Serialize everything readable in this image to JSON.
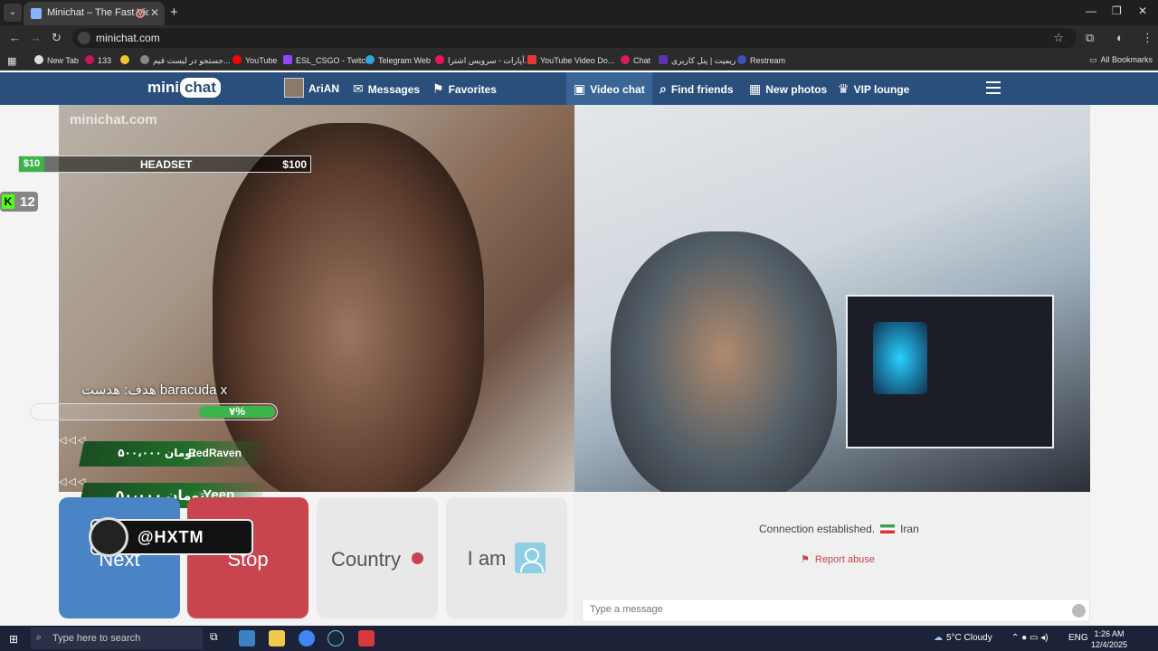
{
  "browser": {
    "tab_title": "Minichat – The Fast Video C",
    "url": "minichat.com",
    "bookmarks": [
      "New Tab",
      "133",
      "",
      "جستجو در لیست قیم...",
      "YouTube",
      "ESL_CSGO - Twitch",
      "Telegram Web",
      "آپارات - سرویس اشترا...",
      "YouTube Video Do...",
      "Chat",
      "ریمیت | پنل کاربری",
      "Restream"
    ],
    "all_bookmarks": "All Bookmarks"
  },
  "site": {
    "logo_a": "mini",
    "logo_b": "chat",
    "nav": {
      "user": "AriAN",
      "messages": "Messages",
      "favorites": "Favorites",
      "video_chat": "Video chat",
      "find_friends": "Find friends",
      "new_photos": "New photos",
      "vip_lounge": "VIP lounge"
    }
  },
  "overlay": {
    "watermark": "minichat.com",
    "headset_low": "$10",
    "headset_label": "HEADSET",
    "headset_high": "$100",
    "kick_count": "12",
    "goal_text": "هدف: هدست baracuda x",
    "progress_label": "۷%",
    "progress_fraction": 0.07,
    "donation1_name": "RedRaven",
    "donation1_amount": "۵۰۰،۰۰۰ تومان",
    "donation2_name": "Yeep",
    "donation2_amount": "۵۰،۰۰۰ تومان",
    "hxtm": "@HXTM"
  },
  "buttons": {
    "next": "Next",
    "stop": "Stop",
    "country": "Country",
    "iam": "I am"
  },
  "chat": {
    "status": "Connection established.",
    "country": "Iran",
    "report": "Report abuse",
    "placeholder": "Type a message"
  },
  "taskbar": {
    "search": "Type here to search",
    "weather": "5°C  Cloudy",
    "lang": "ENG",
    "time": "1:26 AM",
    "date": "12/4/2025"
  }
}
